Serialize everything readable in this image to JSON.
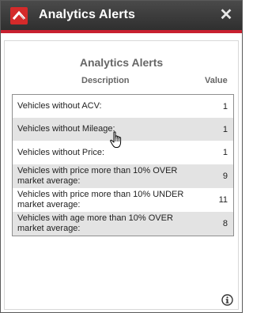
{
  "window": {
    "title": "Analytics Alerts",
    "close_glyph": "✕",
    "accent_color": "#c8202f",
    "logo_icon": "red-chevron-logo-icon"
  },
  "panel": {
    "heading": "Analytics Alerts",
    "col_description": "Description",
    "col_value": "Value"
  },
  "alerts": [
    {
      "description": "Vehicles without ACV:",
      "value": "1"
    },
    {
      "description": "Vehicles without Mileage:",
      "value": "1"
    },
    {
      "description": "Vehicles without Price:",
      "value": "1"
    },
    {
      "description": "Vehicles with price more than 10% OVER market average:",
      "value": "9"
    },
    {
      "description": "Vehicles with price more than 10% UNDER market average:",
      "value": "11"
    },
    {
      "description": "Vehicles with age more than 10% OVER market average:",
      "value": "8"
    }
  ],
  "footer": {
    "info_icon": "info-icon"
  }
}
